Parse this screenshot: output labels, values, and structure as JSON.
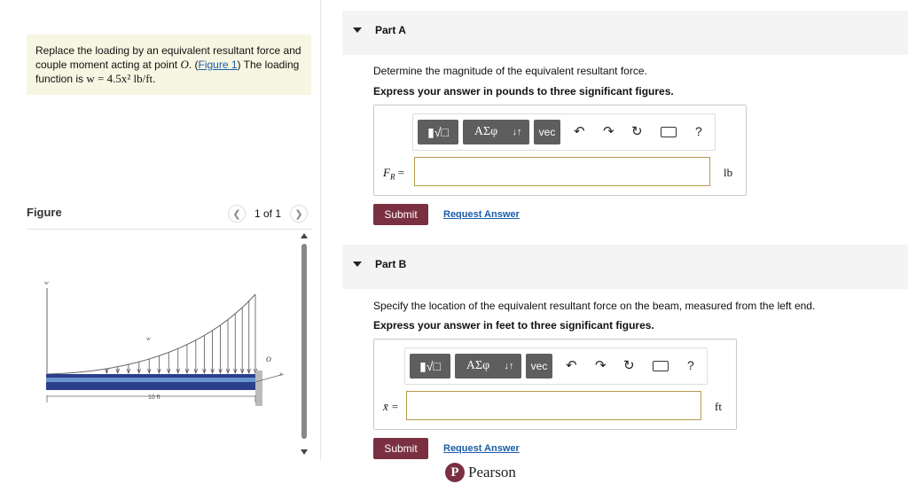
{
  "problem": {
    "text1": "Replace the loading by an equivalent resultant force and couple moment acting at point ",
    "point": "O",
    "text2": ". (",
    "figure_link": "Figure 1",
    "text3": ") The loading function is ",
    "equation": "w = 4.5x² lb/ft."
  },
  "figure": {
    "title": "Figure",
    "pager": "1 of 1",
    "prev_icon": "chevron-left-icon",
    "next_icon": "chevron-right-icon",
    "labels": {
      "w_axis": "w",
      "w_curve": "w",
      "point": "O",
      "x_axis": "x",
      "length": "10 ft"
    }
  },
  "partA": {
    "title": "Part A",
    "question": "Determine the magnitude of the equivalent resultant force.",
    "instruction": "Express your answer in pounds to three significant figures.",
    "var_label": "F",
    "var_sub": "R",
    "var_eq": " =",
    "value": "",
    "unit": "lb",
    "submit": "Submit",
    "request": "Request Answer"
  },
  "partB": {
    "title": "Part B",
    "question": "Specify the location of the equivalent resultant force on the beam, measured from the left end.",
    "instruction": "Express your answer in feet to three significant figures.",
    "var_label": "x̄ =",
    "value": "",
    "unit": "ft",
    "submit": "Submit",
    "request": "Request Answer"
  },
  "toolbar": {
    "greek": "ΑΣφ",
    "arrows": "↓↑",
    "vec": "vec",
    "undo_icon": "undo-icon",
    "redo_icon": "redo-icon",
    "reset_icon": "reset-icon",
    "keyboard_icon": "keyboard-icon",
    "help": "?"
  },
  "brand": {
    "name": "Pearson",
    "logo_letter": "P"
  }
}
